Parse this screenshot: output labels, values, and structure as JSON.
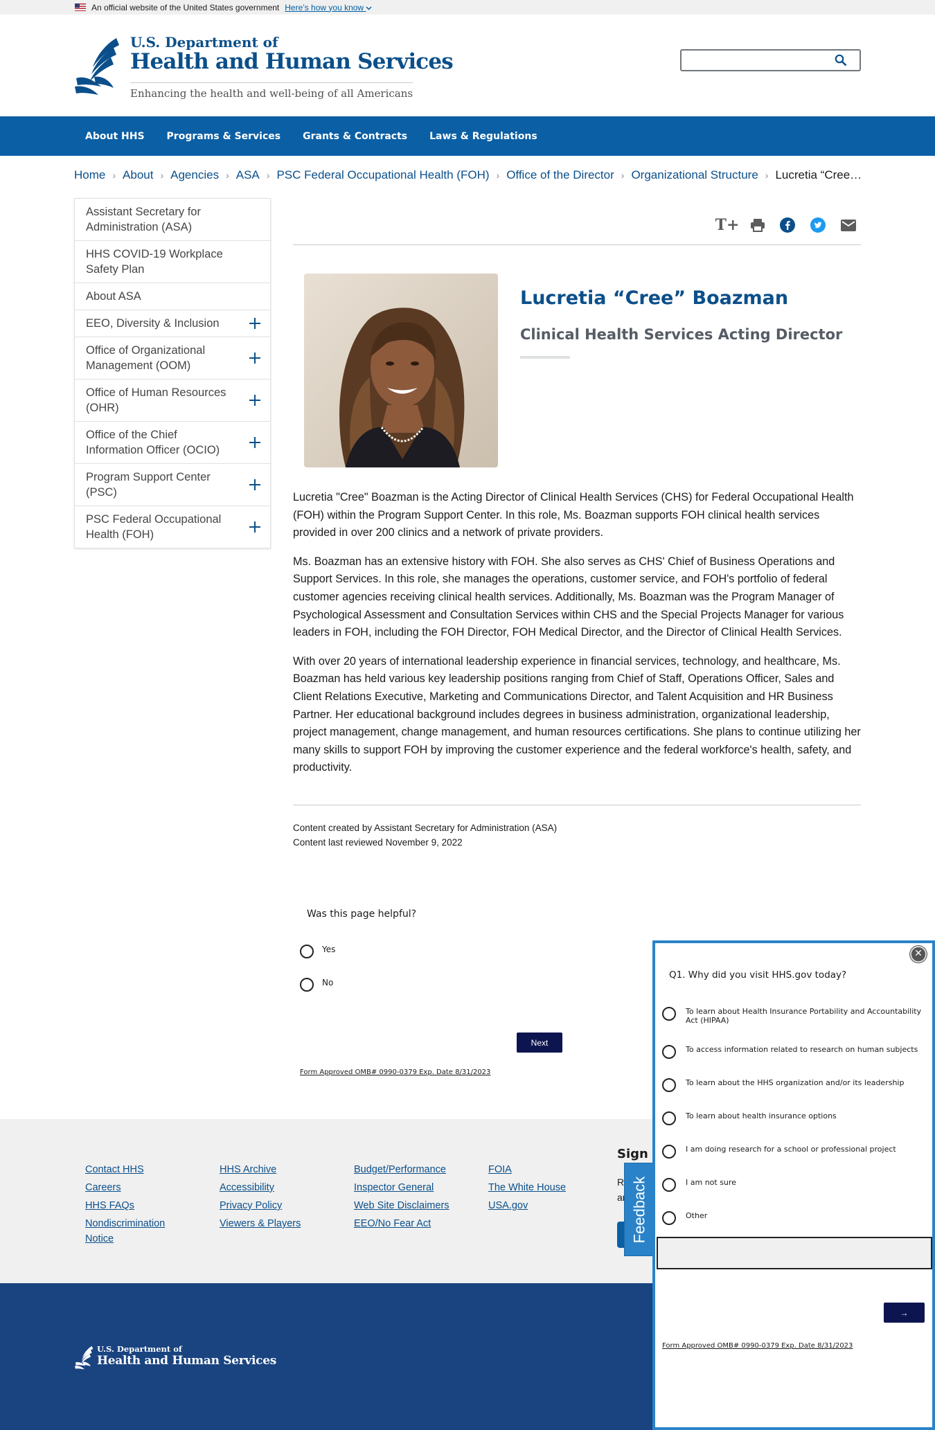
{
  "gov_banner": {
    "text": "An official website of the United States government",
    "link": "Here’s how you know"
  },
  "header": {
    "dept_line": "U.S. Department of",
    "agency": "Health and Human Services",
    "tagline": "Enhancing the health and well-being of all Americans",
    "search_placeholder": ""
  },
  "nav": [
    "About HHS",
    "Programs & Services",
    "Grants & Contracts",
    "Laws & Regulations"
  ],
  "breadcrumb": [
    "Home",
    "About",
    "Agencies",
    "ASA",
    "PSC Federal Occupational Health (FOH)",
    "Office of the Director",
    "Organizational Structure"
  ],
  "breadcrumb_current": "Lucretia “Cree” Boazman",
  "sidenav": [
    {
      "label": "Assistant Secretary for Administration (ASA)",
      "expandable": false
    },
    {
      "label": "HHS COVID-19 Workplace Safety Plan",
      "expandable": false
    },
    {
      "label": "About ASA",
      "expandable": false
    },
    {
      "label": "EEO, Diversity & Inclusion",
      "expandable": true
    },
    {
      "label": "Office of Organizational Management (OOM)",
      "expandable": true
    },
    {
      "label": "Office of Human Resources (OHR)",
      "expandable": true
    },
    {
      "label": "Office of the Chief Information Officer (OCIO)",
      "expandable": true
    },
    {
      "label": "Program Support Center (PSC)",
      "expandable": true
    },
    {
      "label": "PSC Federal Occupational Health (FOH)",
      "expandable": true
    }
  ],
  "toolbar": {
    "resize_glyph": "T+",
    "icons": [
      "resize-text-icon",
      "print-icon",
      "facebook-icon",
      "twitter-icon",
      "email-icon"
    ]
  },
  "profile": {
    "name": "Lucretia “Cree” Boazman",
    "title": "Clinical Health Services Acting Director"
  },
  "body": [
    "Lucretia \"Cree\" Boazman is the Acting Director of Clinical Health Services (CHS) for Federal Occupational Health (FOH) within the Program Support Center. In this role, Ms. Boazman supports FOH clinical health services provided in over 200 clinics and a network of private providers.",
    "Ms. Boazman has an extensive history with FOH. She also serves as CHS' Chief of Business Operations and Support Services. In this role, she manages the operations, customer service, and FOH's portfolio of federal customer agencies receiving clinical health services. Additionally, Ms. Boazman was the Program Manager of Psychological Assessment and Consultation Services within CHS and the Special Projects Manager for various leaders in FOH, including the FOH Director, FOH Medical Director, and the Director of Clinical Health Services.",
    "With over 20 years of international leadership experience in financial services, technology, and healthcare, Ms. Boazman has held various key leadership positions ranging from Chief of Staff, Operations Officer, Sales and Client Relations Executive, Marketing and Communications Director, and Talent Acquisition and HR Business Partner. Her educational background includes degrees in business administration, organizational leadership, project management, change management, and human resources certifications. She plans to continue utilizing her many skills to support FOH by improving the customer experience and the federal workforce's health, safety, and productivity."
  ],
  "meta": {
    "created": "Content created by Assistant Secretary for Administration (ASA)",
    "reviewed": "Content last reviewed November 9, 2022"
  },
  "helpful_survey": {
    "question": "Was this page helpful?",
    "options": [
      "Yes",
      "No"
    ],
    "next": "Next",
    "omb": "Form Approved OMB# 0990-0379 Exp. Date 8/31/2023"
  },
  "footer": {
    "columns": [
      [
        "Contact HHS",
        "Careers",
        "HHS FAQs",
        "Nondiscrimination Notice"
      ],
      [
        "HHS Archive",
        "Accessibility",
        "Privacy Policy",
        "Viewers & Players"
      ],
      [
        "Budget/Performance",
        "Inspector General",
        "Web Site Disclaimers",
        "EEO/No Fear Act"
      ],
      [
        "FOIA",
        "The White House",
        "USA.gov"
      ]
    ],
    "signup_fragment": "Sign U",
    "signup_text_1": "R",
    "signup_text_2": "ar",
    "logo_dept": "U.S. Department of",
    "logo_agency": "Health and Human Services"
  },
  "feedback_tab": "Feedback",
  "visit_survey": {
    "question": "Q1. Why did you visit HHS.gov today?",
    "options": [
      "To learn about Health Insurance Portability and Accountability Act (HIPAA)",
      "To access information related to research on human subjects",
      "To learn about the HHS organization and/or its leadership",
      "To learn about health insurance options",
      "I am doing research for a school or professional project",
      "I am not sure",
      "Other"
    ],
    "other_value": "",
    "arrow": "→",
    "omb": "Form Approved OMB# 0990-0379 Exp. Date 8/31/2023"
  },
  "colors": {
    "brand_blue": "#0b4f8a",
    "nav_blue": "#0b5fa5",
    "footer_navy": "#1a4480",
    "survey_button": "#0d1551",
    "panel_border": "#2a83c9"
  }
}
